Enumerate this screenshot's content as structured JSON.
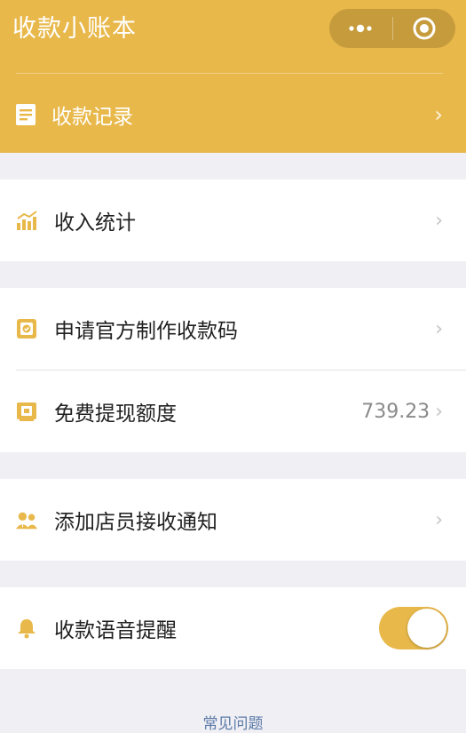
{
  "header": {
    "title": "收款小账本",
    "records_label": "收款记录",
    "background": "#e8b84a"
  },
  "capsule": {
    "more_icon": "more-dots-icon",
    "close_icon": "target-close-icon"
  },
  "menu": {
    "income_stats": "收入统计",
    "apply_code": "申请官方制作收款码",
    "free_withdraw": "免费提现额度",
    "free_withdraw_value": "739.23",
    "add_staff": "添加店员接收通知",
    "voice_alert": "收款语音提醒",
    "voice_alert_on": true
  },
  "footer": {
    "faq": "常见问题"
  },
  "colors": {
    "accent": "#e8b84a",
    "link": "#5b7aa8"
  }
}
